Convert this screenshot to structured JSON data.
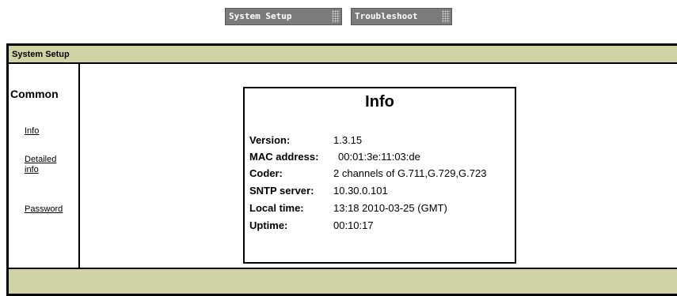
{
  "topnav": {
    "system_setup": "System Setup",
    "troubleshoot": "Troubleshoot"
  },
  "frame": {
    "title": "System Setup"
  },
  "sidebar": {
    "heading": "Common",
    "links": [
      "Info",
      "Detailed info",
      "Password"
    ]
  },
  "info": {
    "title": "Info",
    "rows": [
      {
        "key": "Version:",
        "value": "1.3.15"
      },
      {
        "key": "MAC address:",
        "value": "00:01:3e:11:03:de"
      },
      {
        "key": "Coder:",
        "value": "2 channels of G.711,G.729,G.723"
      },
      {
        "key": "SNTP server:",
        "value": "10.30.0.101"
      },
      {
        "key": "Local time:",
        "value": "13:18 2010-03-25 (GMT)"
      },
      {
        "key": "Uptime:",
        "value": "00:10:17"
      }
    ]
  },
  "colors": {
    "bar": "#d2d3a5",
    "button": "#7b7b7b"
  }
}
